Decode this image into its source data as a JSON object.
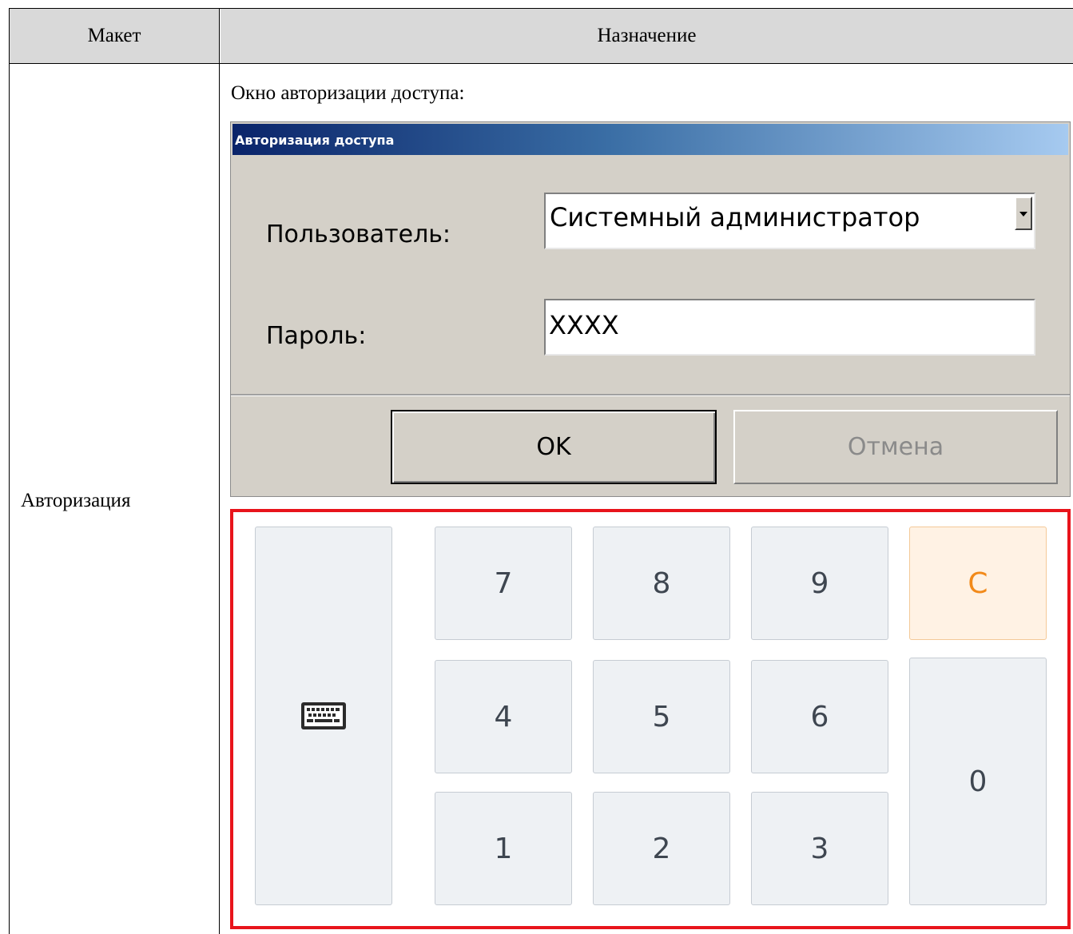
{
  "table": {
    "header_layout": "Макет",
    "header_purpose": "Назначение",
    "row_label": "Авторизация",
    "intro": "Окно авторизации доступа:"
  },
  "dialog": {
    "title": "Авторизация доступа",
    "user_label": "Пользователь:",
    "user_value": "Системный администратор",
    "password_label": "Пароль:",
    "password_value": "XXXX",
    "ok_label": "OK",
    "cancel_label": "Отмена"
  },
  "keypad": {
    "keys": [
      "7",
      "8",
      "9",
      "C",
      "4",
      "5",
      "6",
      "0",
      "1",
      "2",
      "3"
    ],
    "keyboard_icon": "keyboard-icon",
    "clear_color": "#f28a1a",
    "border_color": "#e8141b"
  }
}
